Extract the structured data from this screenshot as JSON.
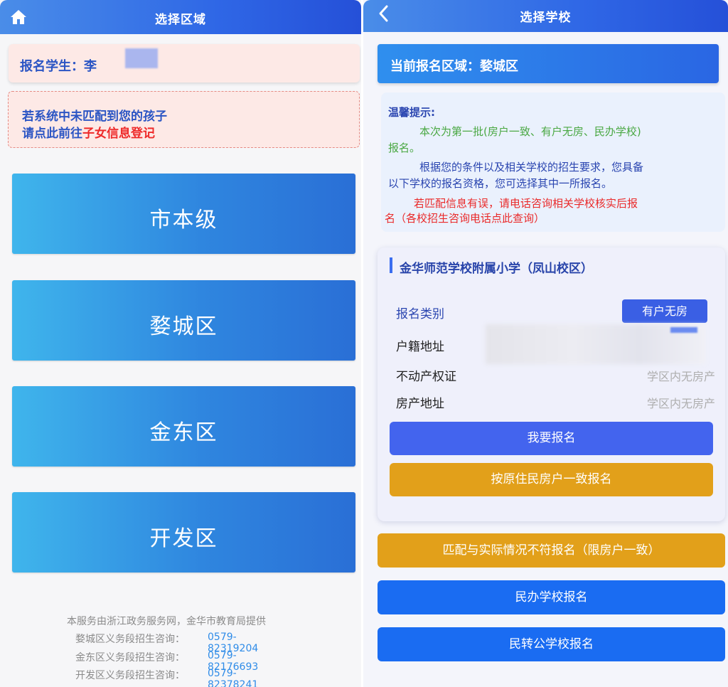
{
  "left": {
    "header_title": "选择区域",
    "student_label": "报名学生：李",
    "match_line1": "若系统中未匹配到您的孩子",
    "match_line2_prefix": "请点此前往",
    "match_link": "子女信息登记",
    "regions": [
      "市本级",
      "婺城区",
      "金东区",
      "开发区"
    ],
    "footer": {
      "provider": "本服务由浙江政务服务网，金华市教育局提供",
      "lines": [
        {
          "label": "婺城区义务段招生咨询：",
          "phone": "0579-82319204"
        },
        {
          "label": "金东区义务段招生咨询：",
          "phone": "0579-82176693"
        },
        {
          "label": "开发区义务段招生咨询：",
          "phone": "0579-82378241"
        }
      ]
    }
  },
  "right": {
    "header_title": "选择学校",
    "current_area": "当前报名区域：婺城区",
    "tips": {
      "title": "温馨提示:",
      "p1_line1": "本次为第一批(房户一致、有户无房、民办学校)",
      "p1_line2": "报名。",
      "p2_line1": "根据您的条件以及相关学校的招生要求，您具备",
      "p2_line2": "以下学校的报名资格，您可选择其中一所报名。",
      "p3_line1": "若匹配信息有误，请电话咨询相关学校核实后报",
      "p3_line2": "名（各校招生咨询电话点此查询）"
    },
    "school": {
      "name": "金华师范学校附属小学（凤山校区）",
      "type_label": "报名类别",
      "type_value": "有户无房",
      "hukou_label": "户籍地址",
      "property_label": "不动产权证",
      "property_value": "学区内无房产",
      "property_addr_label": "房产地址",
      "property_addr_value": "学区内无房产",
      "apply_button": "我要报名",
      "resident_button": "按原住民房户一致报名"
    },
    "buttons": {
      "mismatch": "匹配与实际情况不符报名（限房户一致）",
      "private": "民办学校报名",
      "private_to_public": "民转公学校报名"
    }
  },
  "colors": {
    "header_blue": "#2f67e6",
    "region_button": "#2f86df",
    "link_red": "#ee2a2a",
    "phone_blue": "#2f8ce8",
    "apply_blue": "#4364ee",
    "gold": "#e2a01a",
    "bright_blue": "#1a6cf2",
    "tip_green": "#4aa843"
  },
  "icons": {
    "home": "home-icon",
    "back": "chevron-left-icon"
  }
}
